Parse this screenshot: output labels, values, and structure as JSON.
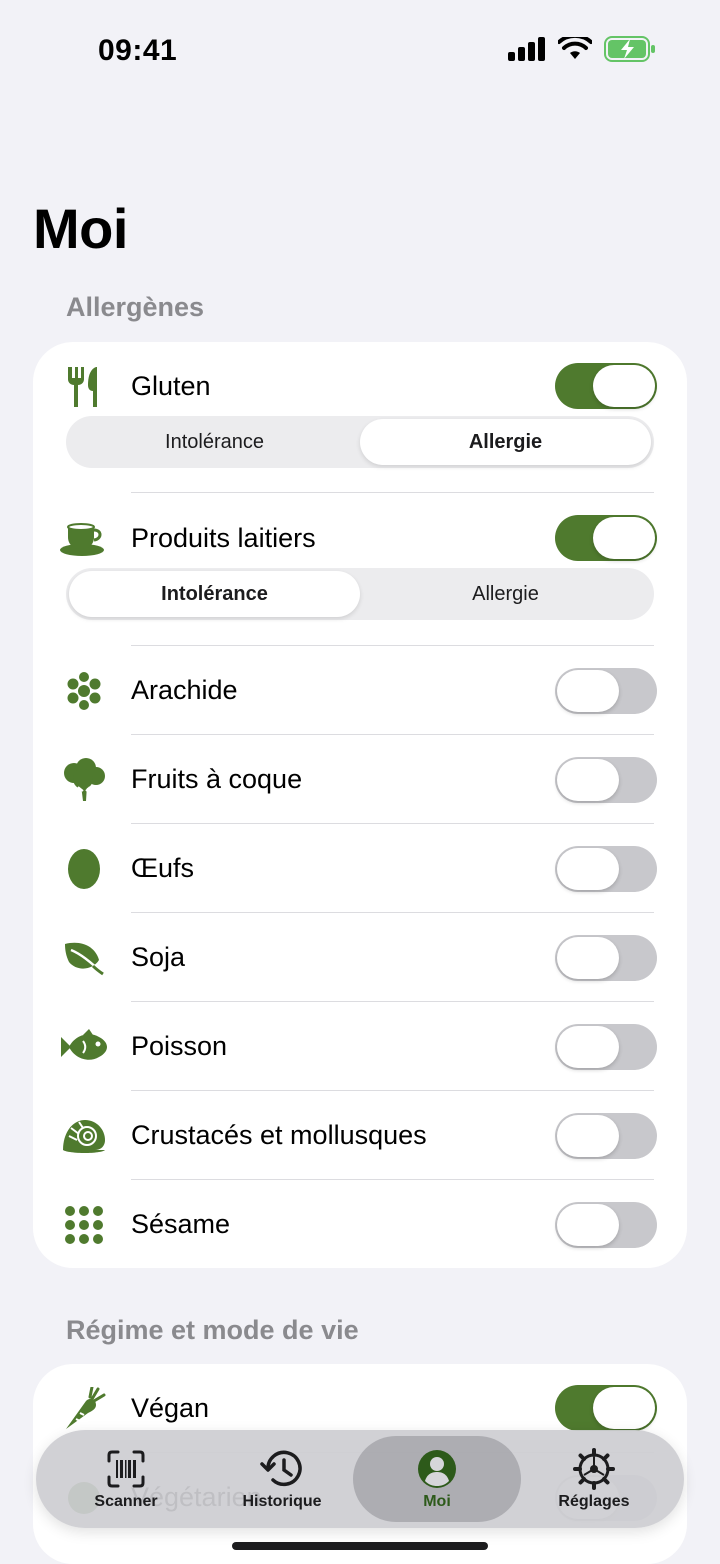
{
  "status_bar": {
    "time": "09:41"
  },
  "page_title": "Moi",
  "allergens": {
    "header": "Allergènes",
    "items": [
      {
        "label": "Gluten",
        "icon": "fork-knife-icon",
        "enabled": true,
        "segments": [
          "Intolérance",
          "Allergie"
        ],
        "selected": "Allergie"
      },
      {
        "label": "Produits laitiers",
        "icon": "cup-icon",
        "enabled": true,
        "segments": [
          "Intolérance",
          "Allergie"
        ],
        "selected": "Intolérance"
      },
      {
        "label": "Arachide",
        "icon": "peanut-icon",
        "enabled": false
      },
      {
        "label": "Fruits à coque",
        "icon": "tree-icon",
        "enabled": false
      },
      {
        "label": "Œufs",
        "icon": "egg-icon",
        "enabled": false
      },
      {
        "label": "Soja",
        "icon": "leaf-icon",
        "enabled": false
      },
      {
        "label": "Poisson",
        "icon": "fish-icon",
        "enabled": false
      },
      {
        "label": "Crustacés et mollusques",
        "icon": "shell-icon",
        "enabled": false
      },
      {
        "label": "Sésame",
        "icon": "sesame-icon",
        "enabled": false
      }
    ]
  },
  "diet": {
    "header": "Régime et mode de vie",
    "items": [
      {
        "label": "Végan",
        "icon": "carrot-icon",
        "enabled": true
      },
      {
        "label": "Végétarien",
        "icon": "vegetarian-icon",
        "enabled": false
      }
    ]
  },
  "tab_bar": {
    "tabs": [
      {
        "label": "Scanner",
        "icon": "barcode-scanner-icon"
      },
      {
        "label": "Historique",
        "icon": "history-clock-icon"
      },
      {
        "label": "Moi",
        "icon": "person-circle-icon",
        "active": true
      },
      {
        "label": "Réglages",
        "icon": "gear-icon"
      }
    ]
  },
  "colors": {
    "accent": "#4f7a2e",
    "background": "#f2f2f7",
    "toggle_off": "#c8c8cc"
  }
}
